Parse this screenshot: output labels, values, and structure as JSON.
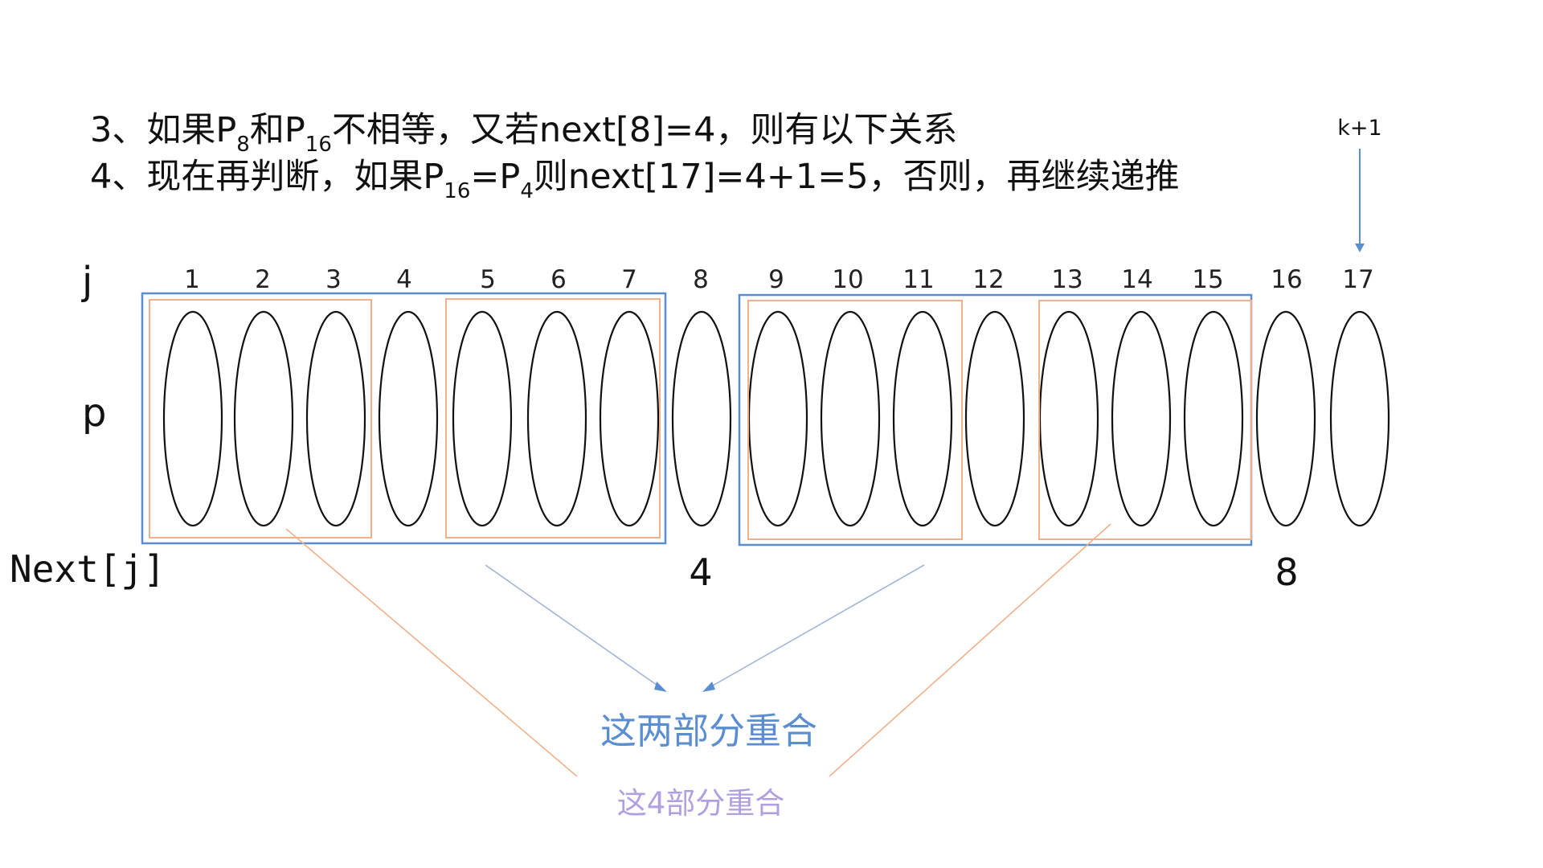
{
  "text": {
    "line1": {
      "part1": "3、如果P",
      "sub1": "8",
      "part2": "和P",
      "sub2": "16",
      "part3": "不相等，又若next[8]=4，则有以下关系"
    },
    "line2": {
      "part1": "4、现在再判断，如果P",
      "sub1": "16",
      "part2": "=P",
      "sub2": "4",
      "part3": "则next[17]=4+1=5，否则，再继续递推"
    },
    "k_plus_1": "k+1",
    "row_labels": {
      "j": "j",
      "p": "p",
      "next": "Next[j]"
    },
    "indices": [
      "1",
      "2",
      "3",
      "4",
      "5",
      "6",
      "7",
      "8",
      "9",
      "10",
      "11",
      "12",
      "13",
      "14",
      "15",
      "16",
      "17"
    ],
    "next_values": {
      "at_8": "4",
      "at_16": "8"
    },
    "caption_blue": "这两部分重合",
    "caption_purple": "这4部分重合"
  },
  "colors": {
    "blue": "#5b8ed0",
    "orange": "#f0b08a",
    "purple": "#b0a0e0",
    "black": "#111111"
  }
}
